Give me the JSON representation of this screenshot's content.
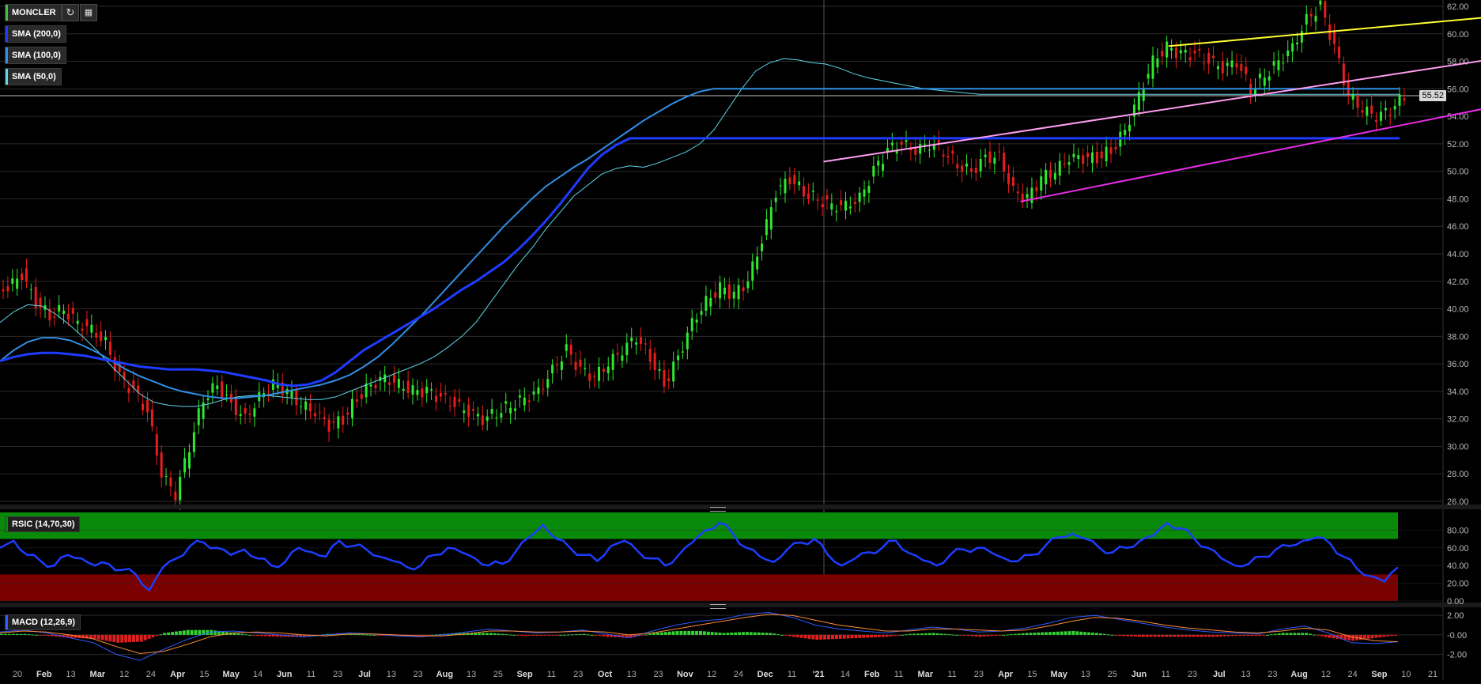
{
  "instrument": {
    "symbol": "MONCLER",
    "symbol_color": "#3fbf3f",
    "last_price": "55.52"
  },
  "toolbar": {
    "refresh_icon": "refresh-icon",
    "ruler_icon": "ruler-icon"
  },
  "indicators": [
    {
      "label": "SMA (200,0)",
      "color": "#1e3cff"
    },
    {
      "label": "SMA (100,0)",
      "color": "#2f8fe6"
    },
    {
      "label": "SMA (50,0)",
      "color": "#5fd6e8"
    }
  ],
  "rsi": {
    "label": "RSIC (14,70,30)",
    "overbought": 70,
    "oversold": 30,
    "upper_band_color": "#0a8a0a",
    "lower_band_color": "#7a0000",
    "line_color": "#1e3cff"
  },
  "macd": {
    "label": "MACD (12,26,9)",
    "macd_color": "#2f5bff",
    "signal_color": "#ff8c3a",
    "hist_pos_color": "#35d435",
    "hist_neg_color": "#e02020"
  },
  "chart_data": [
    {
      "type": "line",
      "title": "MONCLER",
      "xlabel": "",
      "ylabel": "",
      "ylim": [
        26,
        62
      ],
      "price_ticks": [
        "62.00",
        "60.00",
        "58.00",
        "56.00",
        "54.00",
        "52.00",
        "50.00",
        "48.00",
        "46.00",
        "44.00",
        "42.00",
        "40.00",
        "38.00",
        "36.00",
        "34.00",
        "32.00",
        "30.00",
        "28.00",
        "26.00"
      ],
      "x_ticks": [
        "20",
        "Feb",
        "13",
        "Mar",
        "12",
        "24",
        "Apr",
        "15",
        "May",
        "14",
        "Jun",
        "11",
        "23",
        "Jul",
        "13",
        "23",
        "Aug",
        "13",
        "25",
        "Sep",
        "11",
        "23",
        "Oct",
        "13",
        "23",
        "Nov",
        "12",
        "24",
        "Dec",
        "11",
        "'21",
        "14",
        "Feb",
        "11",
        "Mar",
        "11",
        "23",
        "Apr",
        "15",
        "May",
        "13",
        "25",
        "Jun",
        "11",
        "23",
        "Jul",
        "13",
        "23",
        "Aug",
        "12",
        "24",
        "Sep",
        "10",
        "21"
      ],
      "x_ticks_bold": [
        "Feb",
        "Mar",
        "Apr",
        "May",
        "Jun",
        "Jul",
        "Aug",
        "Sep",
        "Oct",
        "Nov",
        "Dec",
        "'21"
      ],
      "series": [
        {
          "name": "MONCLER",
          "values": [
            41.5,
            42.5,
            40.5,
            39.5,
            40.0,
            39.0,
            38.5,
            37.5,
            35.0,
            34.0,
            32.5,
            28.0,
            26.5,
            30.0,
            33.5,
            34.5,
            33.0,
            32.0,
            33.5,
            34.5,
            34.0,
            33.0,
            32.5,
            31.5,
            32.0,
            33.5,
            34.5,
            35.0,
            34.5,
            34.0,
            34.0,
            33.5,
            33.0,
            32.5,
            32.0,
            32.5,
            33.0,
            33.5,
            34.0,
            35.5,
            37.0,
            35.5,
            35.0,
            36.0,
            37.0,
            38.0,
            36.5,
            34.5,
            36.5,
            39.0,
            40.5,
            41.5,
            41.0,
            42.0,
            45.0,
            48.5,
            49.5,
            48.5,
            48.0,
            47.5,
            47.5,
            48.0,
            50.0,
            51.5,
            52.0,
            51.5,
            52.0,
            51.5,
            50.5,
            50.0,
            51.0,
            51.0,
            48.5,
            48.0,
            49.5,
            50.0,
            51.0,
            51.0,
            51.0,
            51.5,
            53.0,
            55.5,
            58.0,
            59.0,
            58.5,
            58.5,
            58.0,
            57.5,
            58.0,
            56.0,
            57.0,
            58.0,
            59.0,
            61.0,
            62.0,
            59.0,
            55.5,
            54.5,
            54.0,
            54.5,
            55.5
          ]
        },
        {
          "name": "SMA (50,0)",
          "values": [
            39.0,
            39.8,
            40.3,
            40.2,
            39.6,
            38.8,
            37.9,
            36.9,
            35.8,
            34.8,
            33.8,
            33.2,
            33.0,
            32.9,
            32.9,
            33.1,
            33.4,
            33.6,
            33.7,
            33.7,
            33.6,
            33.5,
            33.4,
            33.4,
            33.6,
            34.0,
            34.4,
            34.8,
            35.2,
            35.6,
            36.0,
            36.5,
            37.2,
            38.0,
            39.0,
            40.4,
            41.8,
            43.2,
            44.4,
            45.8,
            47.0,
            48.2,
            49.0,
            49.8,
            50.2,
            50.4,
            50.3,
            50.6,
            51.0,
            51.4,
            52.0,
            53.0,
            54.5,
            56.0,
            57.3,
            57.9,
            58.2,
            58.1,
            57.9,
            57.8,
            57.5,
            57.1,
            56.8,
            56.6,
            56.4,
            56.2,
            56.0,
            55.9,
            55.8,
            55.7,
            55.6,
            55.6,
            55.6,
            55.6,
            55.6,
            55.6,
            55.6,
            55.6,
            55.6,
            55.6,
            55.6,
            55.6,
            55.6,
            55.6,
            55.6,
            55.6,
            55.6,
            55.6,
            55.6,
            55.6,
            55.6,
            55.6,
            55.6,
            55.6,
            55.6,
            55.6,
            55.6,
            55.6,
            55.6,
            55.6,
            55.6
          ]
        },
        {
          "name": "SMA (100,0)",
          "values": [
            36.2,
            37.0,
            37.6,
            37.9,
            37.9,
            37.7,
            37.3,
            36.8,
            36.2,
            35.6,
            35.1,
            34.7,
            34.3,
            34.0,
            33.8,
            33.6,
            33.5,
            33.5,
            33.6,
            33.7,
            33.9,
            34.1,
            34.3,
            34.5,
            34.8,
            35.2,
            35.8,
            36.5,
            37.4,
            38.4,
            39.4,
            40.5,
            41.6,
            42.7,
            43.8,
            44.9,
            46.0,
            47.0,
            48.0,
            48.9,
            49.6,
            50.3,
            50.9,
            51.6,
            52.3,
            53.0,
            53.7,
            54.3,
            54.9,
            55.4,
            55.8,
            56.0,
            56.0,
            56.0,
            56.0,
            56.0,
            56.0,
            56.0,
            56.0,
            56.0,
            56.0,
            56.0,
            56.0,
            56.0,
            56.0,
            56.0,
            56.0,
            56.0,
            56.0,
            56.0,
            56.0,
            56.0,
            56.0,
            56.0,
            56.0,
            56.0,
            56.0,
            56.0,
            56.0,
            56.0,
            56.0,
            56.0,
            56.0,
            56.0,
            56.0,
            56.0,
            56.0,
            56.0,
            56.0,
            56.0,
            56.0,
            56.0,
            56.0,
            56.0,
            56.0,
            56.0,
            56.0,
            56.0,
            56.0,
            56.0,
            56.0
          ]
        },
        {
          "name": "SMA (200,0)",
          "values": [
            36.2,
            36.5,
            36.7,
            36.8,
            36.8,
            36.7,
            36.6,
            36.4,
            36.2,
            36.0,
            35.8,
            35.7,
            35.6,
            35.6,
            35.6,
            35.5,
            35.4,
            35.2,
            35.0,
            34.8,
            34.5,
            34.4,
            34.5,
            34.8,
            35.4,
            36.2,
            37.0,
            37.6,
            38.2,
            38.8,
            39.4,
            40.0,
            40.7,
            41.4,
            42.0,
            42.7,
            43.4,
            44.3,
            45.3,
            46.4,
            47.6,
            48.9,
            50.2,
            51.2,
            51.9,
            52.4,
            52.4,
            52.4,
            52.4,
            52.4,
            52.4,
            52.4,
            52.4,
            52.4,
            52.4,
            52.4,
            52.4,
            52.4,
            52.4,
            52.4,
            52.4,
            52.4,
            52.4,
            52.4,
            52.4,
            52.4,
            52.4,
            52.4,
            52.4,
            52.4,
            52.4,
            52.4,
            52.4,
            52.4,
            52.4,
            52.4,
            52.4,
            52.4,
            52.4,
            52.4,
            52.4,
            52.4,
            52.4,
            52.4,
            52.4,
            52.4,
            52.4,
            52.4,
            52.4,
            52.4,
            52.4,
            52.4,
            52.4,
            52.4,
            52.4,
            52.4,
            52.4,
            52.4,
            52.4,
            52.4,
            52.4
          ]
        }
      ],
      "trendlines": [
        {
          "color": "#ffff33",
          "from": [
            0.789,
            59.1
          ],
          "to": [
            0.972,
            61.2
          ]
        },
        {
          "color": "#ff9cf0",
          "from": [
            0.556,
            50.7
          ],
          "to": [
            0.972,
            58.1
          ]
        },
        {
          "color": "#e62ee6",
          "from": [
            0.689,
            47.8
          ],
          "to": [
            0.972,
            54.6
          ]
        }
      ],
      "horizontal_line": 55.52,
      "grid": true,
      "legend": "top-left"
    },
    {
      "type": "line",
      "title": "RSIC (14,70,30)",
      "ylim": [
        0,
        100
      ],
      "ticks": [
        "80.00",
        "60.00",
        "40.00",
        "20.00",
        "0.00"
      ],
      "series": [
        {
          "name": "RSIC",
          "values": [
            60,
            68,
            52,
            45,
            40,
            52,
            48,
            40,
            42,
            35,
            30,
            12,
            38,
            48,
            62,
            66,
            60,
            52,
            58,
            48,
            40,
            44,
            60,
            55,
            50,
            68,
            62,
            58,
            50,
            45,
            38,
            40,
            52,
            60,
            55,
            48,
            40,
            42,
            56,
            72,
            86,
            70,
            60,
            52,
            45,
            62,
            68,
            56,
            48,
            40,
            52,
            66,
            80,
            88,
            76,
            60,
            50,
            44,
            58,
            66,
            70,
            52,
            40,
            48,
            55,
            60,
            68,
            54,
            46,
            40,
            52,
            58,
            60,
            55,
            48,
            45,
            52,
            62,
            72,
            76,
            70,
            60,
            55,
            60,
            68,
            74,
            88,
            82,
            70,
            60,
            48,
            40,
            42,
            50,
            58,
            62,
            68,
            72,
            65,
            50,
            36,
            28,
            22,
            38
          ]
        }
      ],
      "legend": "top-left"
    },
    {
      "type": "line",
      "title": "MACD (12,26,9)",
      "ylim": [
        -3,
        2.5
      ],
      "ticks": [
        "2.00",
        "-0.00",
        "-2.00"
      ],
      "series": [
        {
          "name": "MACD",
          "values": [
            0.3,
            0.5,
            0.2,
            -0.3,
            -0.8,
            -2.0,
            -2.6,
            -1.5,
            -0.5,
            0.3,
            0.4,
            0.2,
            0.0,
            -0.2,
            0.0,
            0.2,
            0.1,
            -0.1,
            -0.2,
            0.0,
            0.3,
            0.6,
            0.4,
            0.2,
            0.3,
            0.5,
            0.1,
            -0.3,
            0.4,
            1.0,
            1.4,
            1.6,
            2.1,
            2.3,
            1.8,
            1.0,
            0.6,
            0.4,
            0.2,
            0.5,
            0.8,
            0.6,
            0.3,
            0.4,
            0.7,
            1.2,
            1.8,
            2.0,
            1.6,
            1.2,
            0.8,
            0.5,
            0.3,
            0.2,
            0.1,
            0.6,
            0.9,
            0.2,
            -0.8,
            -0.9,
            -0.7
          ]
        },
        {
          "name": "Signal",
          "values": [
            0.2,
            0.4,
            0.3,
            0.0,
            -0.4,
            -1.2,
            -1.9,
            -1.7,
            -1.0,
            -0.2,
            0.2,
            0.3,
            0.2,
            0.0,
            -0.1,
            0.1,
            0.1,
            0.0,
            -0.1,
            -0.1,
            0.1,
            0.4,
            0.4,
            0.3,
            0.3,
            0.4,
            0.3,
            0.0,
            0.2,
            0.6,
            1.0,
            1.4,
            1.8,
            2.1,
            2.0,
            1.5,
            1.0,
            0.7,
            0.4,
            0.4,
            0.6,
            0.6,
            0.5,
            0.4,
            0.5,
            0.9,
            1.4,
            1.8,
            1.7,
            1.4,
            1.0,
            0.7,
            0.5,
            0.3,
            0.2,
            0.4,
            0.7,
            0.5,
            -0.2,
            -0.6,
            -0.7
          ]
        }
      ],
      "legend": "top-left"
    }
  ]
}
